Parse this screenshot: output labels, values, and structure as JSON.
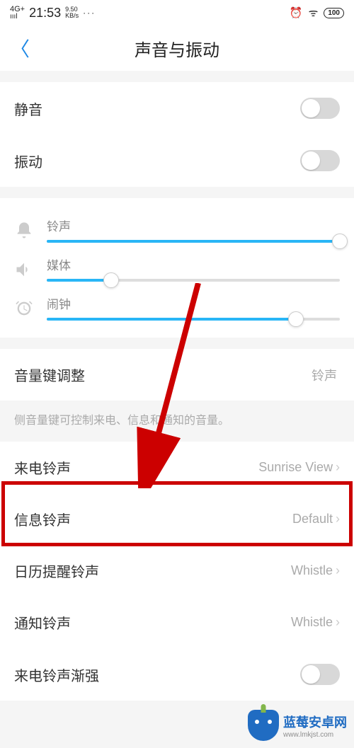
{
  "status": {
    "signal": "4G+",
    "time": "21:53",
    "speed_top": "9.50",
    "speed_bottom": "KB/s",
    "dots": "···",
    "alarm": "⏰",
    "wifi": "ᯤ",
    "battery": "100"
  },
  "header": {
    "back": "〈",
    "title": "声音与振动"
  },
  "toggles": {
    "mute": {
      "label": "静音",
      "on": false
    },
    "vibrate": {
      "label": "振动",
      "on": false
    }
  },
  "sliders": {
    "ring": {
      "label": "铃声",
      "percent": 100
    },
    "media": {
      "label": "媒体",
      "percent": 22
    },
    "alarm": {
      "label": "闹钟",
      "percent": 85
    }
  },
  "volkey": {
    "label": "音量键调整",
    "value": "铃声",
    "hint": "侧音量键可控制来电、信息和通知的音量。"
  },
  "ringtones": {
    "call": {
      "label": "来电铃声",
      "value": "Sunrise View"
    },
    "msg": {
      "label": "信息铃声",
      "value": "Default"
    },
    "cal": {
      "label": "日历提醒铃声",
      "value": "Whistle"
    },
    "notif": {
      "label": "通知铃声",
      "value": "Whistle"
    },
    "ramp": {
      "label": "来电铃声渐强",
      "on": false
    }
  },
  "watermark": {
    "title": "蓝莓安卓网",
    "url": "www.lmkjst.com"
  }
}
